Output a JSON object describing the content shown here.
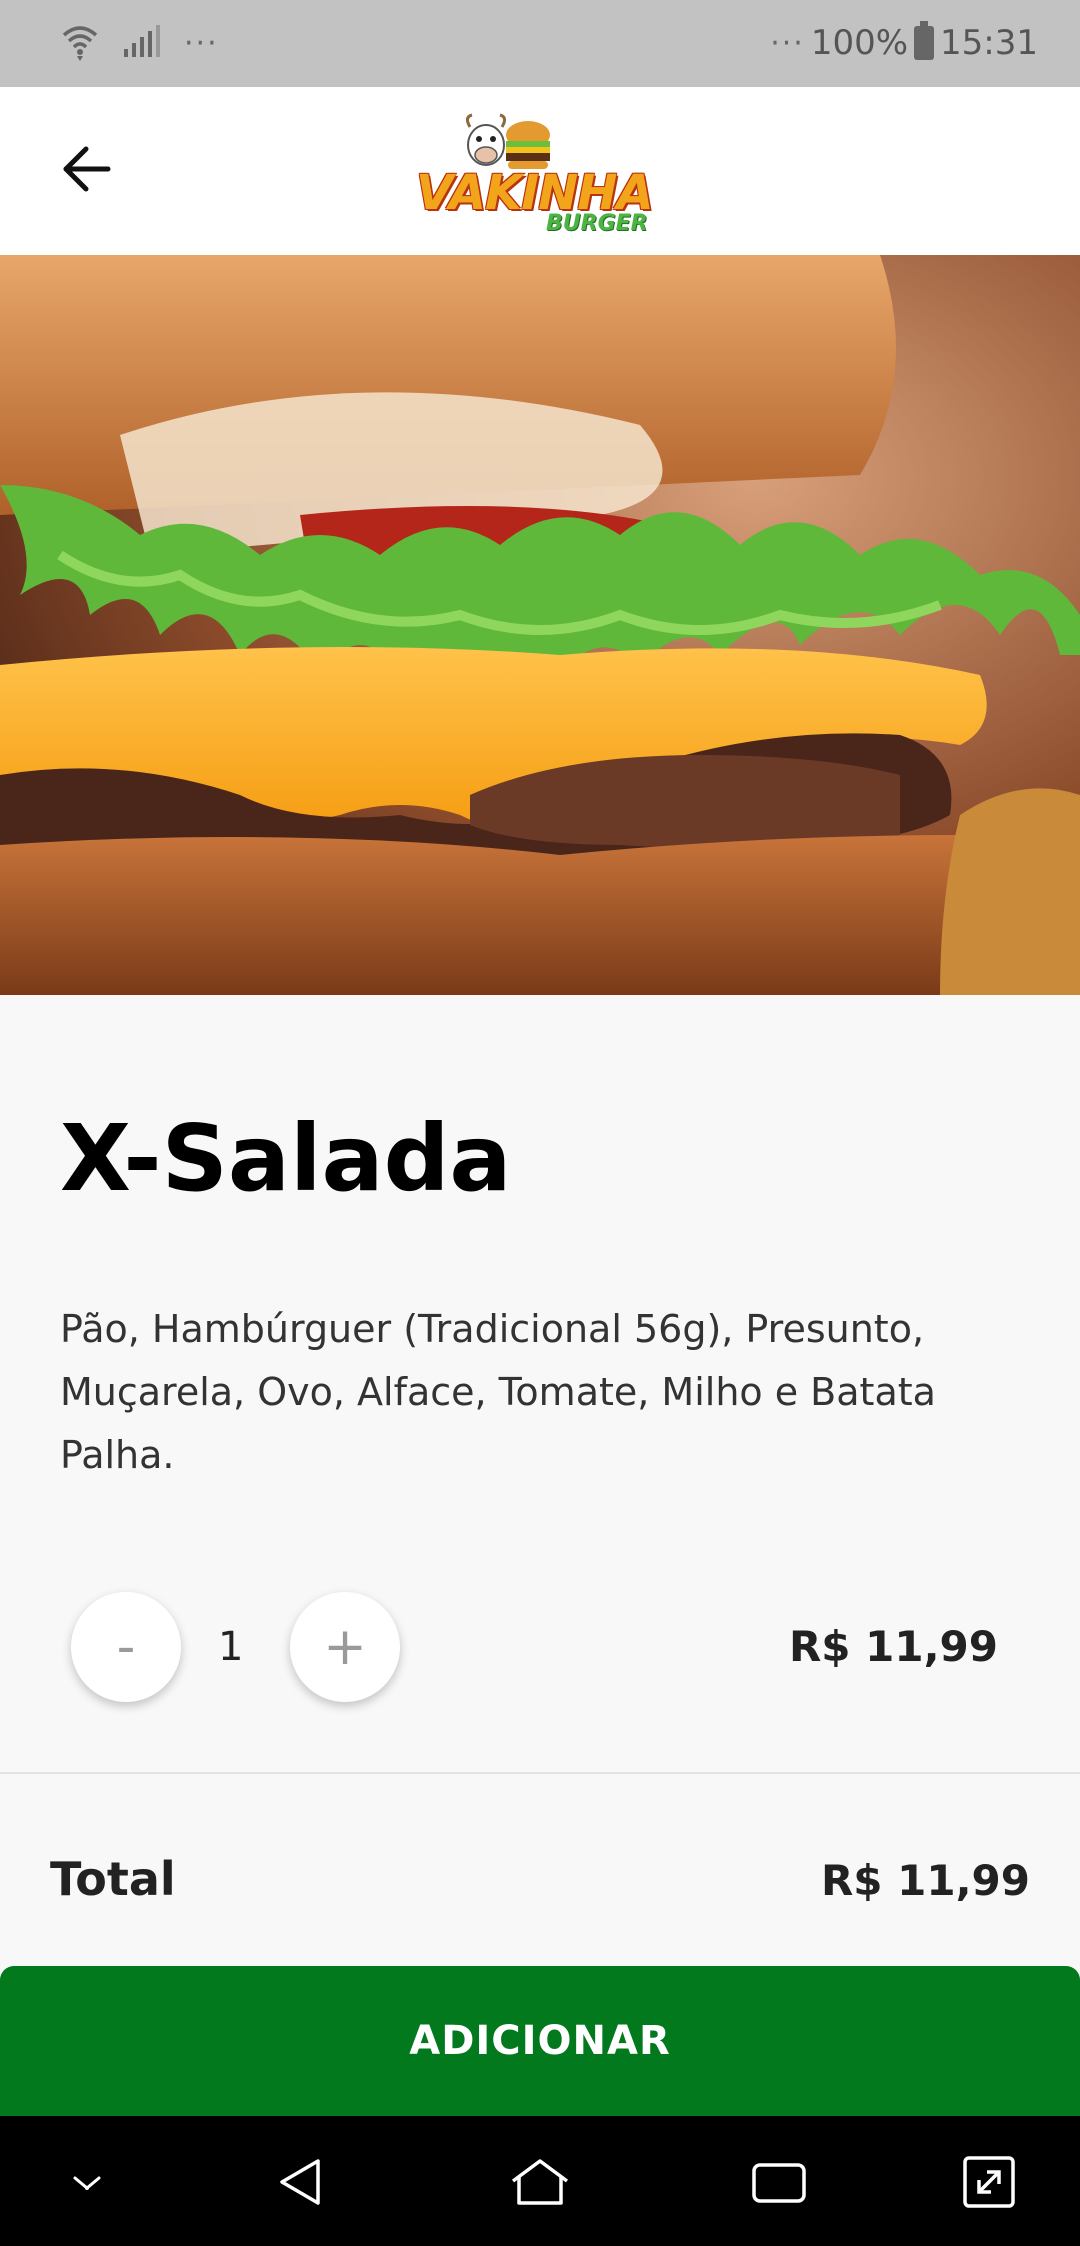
{
  "status_bar": {
    "overflow_left": "···",
    "overflow_right": "···",
    "battery": "100%",
    "time": "15:31"
  },
  "app_bar": {
    "logo_text_main": "VAKINHA",
    "logo_text_sub": "BURGER"
  },
  "product": {
    "name": "X-Salada",
    "description": "Pão, Hambúrguer (Tradicional 56g), Presunto, Muçarela, Ovo, Alface, Tomate, Milho e Batata Palha.",
    "quantity": "1",
    "minus_label": "-",
    "plus_label": "+",
    "unit_price": "R$ 11,99"
  },
  "summary": {
    "total_label": "Total",
    "total_value": "R$ 11,99"
  },
  "actions": {
    "add_label": "ADICIONAR"
  },
  "icons": {
    "back": "arrow-left-icon",
    "wifi": "wifi-icon",
    "signal": "signal-icon",
    "battery": "battery-icon",
    "nav_down": "chevron-down-icon",
    "nav_back": "triangle-back-icon",
    "nav_home": "home-icon",
    "nav_recent": "recent-apps-icon",
    "nav_expand": "expand-icon"
  },
  "colors": {
    "accent": "#02791d",
    "status_bar": "#c2c2c2"
  }
}
